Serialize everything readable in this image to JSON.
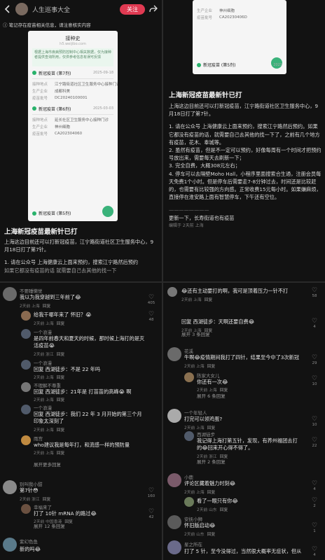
{
  "header": {
    "author": "人生巡事大全",
    "follow": "关注",
    "note_prompt": "笔记存在疫苗相关信息，请注意核实内容"
  },
  "screenshot_card": {
    "title": "接种史",
    "subtitle": "h5.weijibo.com",
    "notice": "根据上海市疾病预防控制中心相关数据，仅为接种者提供查询所用，仅供参考信息有误可反馈",
    "section1": {
      "name": "新冠疫苗 (第7剂)",
      "date": "2025-09-18"
    },
    "rows1": [
      {
        "label": "接种地点",
        "value": "江宁路街道社区卫生服务中心接种门诊"
      },
      {
        "label": "生产企业",
        "value": "成都科美"
      },
      {
        "label": "疫苗批号",
        "value": "DC20240100001"
      }
    ],
    "section2": {
      "name": "新冠疫苗 (第6剂)",
      "date": "2025-03-03"
    },
    "rows2": [
      {
        "label": "接种地点",
        "value": "延长社区卫生服务中心接种门诊"
      },
      {
        "label": "生产企业",
        "value": "神州细胞"
      },
      {
        "label": "疫苗批号",
        "value": "CA202304060"
      }
    ],
    "section3": {
      "name": "新冠疫苗 (第5剂)",
      "date": "2023"
    }
  },
  "right_card": {
    "rows": [
      {
        "label": "生产企业",
        "value": "神州细胞"
      },
      {
        "label": "疫苗批号",
        "value": "CA20230406D"
      }
    ],
    "section": {
      "name": "新冠疫苗 (第5剂)",
      "date": "2023"
    }
  },
  "post": {
    "title": "上海新冠疫苗最新针已打",
    "intro": "上海这边目前还可以打新冠疫苗，江宁路街道社区卫生服务中心，9月18日打了第7针。",
    "p1": "1. 请在公众号 上海健康云上面来预约，搜索江宁路然后预约。如果它都没有疫苗的话，就需要自己去其他的找一下了，之前有几个地方有疫苗，花木、奉城等。",
    "p2": "2. 虽然有疫苗，但是不一定可以预约，好像每周有一个时间才把预约号放出来，需要每天去刷新一下；",
    "p3": "3. 完全自费，大概308元左右；",
    "p4": "4. 停车可以去隔壁Moho Hall，小程序里面搜索合生通，注册会员每天免费1个小时。但是停车后需要走7-8分钟过去，时间还是比较赶的，也需要有比较强的方向感。正常收费15元每小时。如果嫌麻烦，直接停在淮安路上面有智慧停车，下午还有空位。",
    "divider": "————————",
    "edited": "更新一下，长寿街道也有疫苗",
    "edited_meta": "编辑于 2天前 上海",
    "left_truncated_1": "1. 请在公众号 上海健康云上面来预约，搜索江宁路然后预约",
    "left_truncated_2": "如果它都没有疫苗的话 就需要自己去其他的找一下"
  },
  "comments_left": [
    {
      "name": "不要睡懒觉",
      "text": "我以为我穿越到三年前了😂",
      "meta": "2天前 上海",
      "reply": "回复",
      "likes": "405"
    },
    {
      "name": "",
      "text": "给我干哪年来了 怀旧？😭",
      "meta": "2天前 上海",
      "reply": "回复",
      "likes": "48"
    },
    {
      "name": "一个浪漫",
      "text": "是四年前春天和夏天的时候，那时候上海打的是灭活疫苗😭",
      "meta": "2天前 浙江",
      "reply": "回复",
      "likes": ""
    },
    {
      "name": "一个浪漫",
      "text": "回复 西湖徒步：不是 22 年吗",
      "meta": "2天前 上海",
      "reply": "回复",
      "likes": ""
    },
    {
      "name": "不理解不尊重",
      "text": "回复 西湖徒步：21年是 打苗苗的高峰😭 啊",
      "meta": "2天前 上海",
      "reply": "回复",
      "likes": ""
    },
    {
      "name": "一个浪漫",
      "text": "回复 西湖徒步：我们 22 年 3 月开始的第三个月印象太深刻了",
      "meta": "2天前 上海",
      "reply": "回复",
      "likes": ""
    },
    {
      "name": "雨宫",
      "text": "who建议我是每年打，和流感一样的预防量",
      "meta": "2天前 上海",
      "reply": "回复",
      "likes": ""
    },
    {
      "name": "展开更多回复",
      "text": "",
      "meta": "",
      "reply": "",
      "likes": ""
    },
    {
      "name": "别叫我小甜",
      "text": "第7针😳",
      "meta": "2天前 浙江",
      "reply": "回复",
      "likes": "160"
    },
    {
      "name": "幸福来了",
      "text": "打了 10针 mRNA 的路过😂",
      "meta": "2天前 中国香港",
      "reply": "回复",
      "likes": "42"
    },
    {
      "name": "展开 12 条回复",
      "text": "",
      "meta": "",
      "reply": "",
      "likes": ""
    },
    {
      "name": "紫幻色鱼",
      "text": "新的吗😂",
      "meta": "",
      "reply": "",
      "likes": ""
    }
  ],
  "comments_right": [
    {
      "name": "",
      "text": "😂还有主动要打的啊，我可是顶着压力一针不打",
      "meta": "2天前 上海",
      "reply": "回复",
      "likes": "58"
    },
    {
      "name": "",
      "text": "回复 西湖徒步：天啊还要自费😂",
      "meta": "2天前 上海",
      "reply": "回复",
      "likes": "4"
    },
    {
      "name": "展开 3 条回复",
      "text": "",
      "meta": "",
      "reply": "",
      "likes": ""
    },
    {
      "name": "花溪",
      "text": "牛啊😂疫情期间我打了四针，结果至今中了3次新冠",
      "meta": "2天前 上海",
      "reply": "回复",
      "likes": "29"
    },
    {
      "name": "陈家大女儿",
      "text": "你还有一次😂",
      "meta": "2天前 上海",
      "reply": "回复",
      "likes": "10"
    },
    {
      "name": "展开 6 条回复",
      "text": "",
      "meta": "",
      "reply": "",
      "likes": ""
    },
    {
      "name": "一个年轻人",
      "text": "打完可以领鸡蛋?",
      "meta": "2天前 上海",
      "reply": "回复",
      "likes": "10"
    },
    {
      "name": "西湖徒步",
      "text": "我记得上海打第五针，发现，有养州福团去打的😂回来开心得不得了。",
      "meta": "2天前 浙江",
      "reply": "回复",
      "likes": "22"
    },
    {
      "name": "展开 2 条回复",
      "text": "",
      "meta": "",
      "reply": "",
      "likes": ""
    },
    {
      "name": "小鹿",
      "text": "评论区藏着魅力时刻😂",
      "meta": "2天前 上海",
      "reply": "回复",
      "likes": "4"
    },
    {
      "name": "",
      "text": "看了一眼只有你😂",
      "meta": "2天前 山东",
      "reply": "回复",
      "likes": "2"
    },
    {
      "name": "安抚小狮",
      "text": "怀旧版启动😂",
      "meta": "2天前 山东",
      "reply": "回复",
      "likes": "1"
    },
    {
      "name": "星之所在",
      "text": "打了 5 针，至今没得过，当然很大概率无症状，但从",
      "meta": "",
      "reply": "",
      "likes": "4"
    }
  ]
}
